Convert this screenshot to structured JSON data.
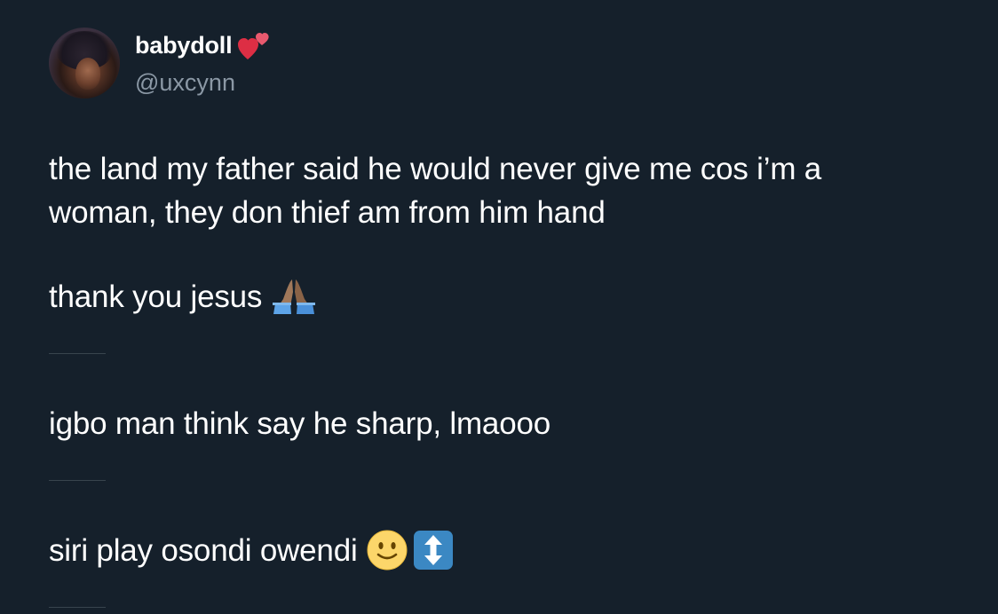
{
  "user": {
    "display_name": "babydoll",
    "handle": "@uxcynn",
    "display_name_emoji": "two-hearts-icon"
  },
  "tweet": {
    "line1": "the land my father said he would never give me cos i’m a",
    "line2": "woman, they don thief am from him hand",
    "line3": "thank you jesus",
    "line3_emoji": "folded-hands-icon",
    "line4": "igbo man think say he sharp, lmaooo",
    "line5": "siri play osondi owendi",
    "line5_emojis": [
      "slightly-smiling-face-icon",
      "up-down-arrow-icon"
    ]
  },
  "colors": {
    "background": "#15202b",
    "text": "#ffffff",
    "secondary_text": "#8b98a5",
    "divider": "#38444d",
    "heart": "#e0245e"
  }
}
